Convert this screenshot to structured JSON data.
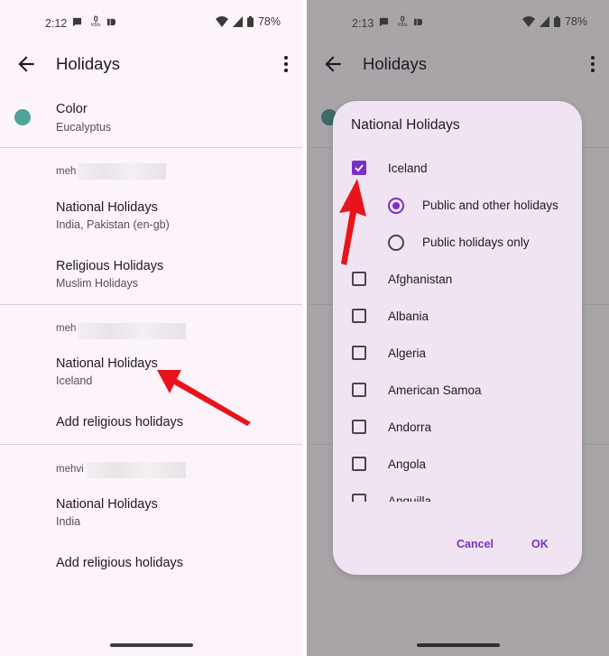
{
  "left": {
    "status": {
      "time": "2:12",
      "kb_top": "0",
      "kb_bottom": "KB/s",
      "battery": "78%"
    },
    "appbar": {
      "title": "Holidays"
    },
    "color": {
      "title": "Color",
      "value": "Eucalyptus"
    },
    "accounts": [
      {
        "label": "meh",
        "national": {
          "title": "National Holidays",
          "sub": "India, Pakistan (en-gb)"
        },
        "religious": {
          "title": "Religious Holidays",
          "sub": "Muslim Holidays"
        }
      },
      {
        "label": "meh",
        "national": {
          "title": "National Holidays",
          "sub": "Iceland"
        },
        "religious": {
          "title": "Add religious holidays"
        }
      },
      {
        "label": "mehvi",
        "national": {
          "title": "National Holidays",
          "sub": "India"
        },
        "religious": {
          "title": "Add religious holidays"
        }
      }
    ]
  },
  "right": {
    "status": {
      "time": "2:13",
      "kb_top": "0",
      "kb_bottom": "KB/s",
      "battery": "78%"
    },
    "appbar": {
      "title": "Holidays"
    },
    "dialog": {
      "title": "National Holidays",
      "items": [
        {
          "label": "Iceland",
          "checked": true
        },
        {
          "label": "Afghanistan",
          "checked": false
        },
        {
          "label": "Albania",
          "checked": false
        },
        {
          "label": "Algeria",
          "checked": false
        },
        {
          "label": "American Samoa",
          "checked": false
        },
        {
          "label": "Andorra",
          "checked": false
        },
        {
          "label": "Angola",
          "checked": false
        },
        {
          "label": "Anguilla",
          "checked": false
        }
      ],
      "radios": [
        {
          "label": "Public and other holidays",
          "selected": true
        },
        {
          "label": "Public holidays only",
          "selected": false
        }
      ],
      "cancel": "Cancel",
      "ok": "OK"
    }
  },
  "colors": {
    "accent": "#7a2fc7",
    "swatch": "#4fa397",
    "arrow": "#e8141b"
  }
}
